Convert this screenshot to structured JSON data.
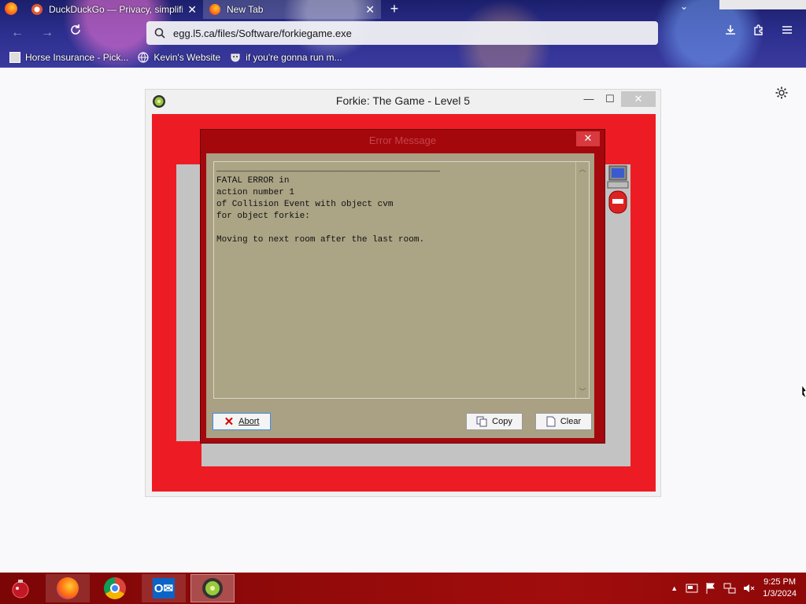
{
  "browser": {
    "tabs": [
      {
        "title": "DuckDuckGo — Privacy, simplified.",
        "active": false
      },
      {
        "title": "New Tab",
        "active": true
      }
    ],
    "url": "egg.l5.ca/files/Software/forkiegame.exe",
    "bookmarks": [
      {
        "label": "Horse Insurance - Pick..."
      },
      {
        "label": "Kevin's Website"
      },
      {
        "label": "if you're gonna run m..."
      }
    ]
  },
  "game_window": {
    "title": "Forkie: The Game - Level 5"
  },
  "error_dialog": {
    "title": "Error Message",
    "text": "___________________________________________\nFATAL ERROR in\naction number 1\nof Collision Event with object cvm\nfor object forkie:\n\nMoving to next room after the last room.",
    "buttons": {
      "abort": "Abort",
      "copy": "Copy",
      "clear": "Clear"
    }
  },
  "taskbar": {
    "time": "9:25 PM",
    "date": "1/3/2024"
  },
  "colors": {
    "game_bg": "#ed1c24",
    "dialog_frame": "#a4080d",
    "dialog_body": "#aaa084",
    "taskbar": "#930a0a"
  }
}
